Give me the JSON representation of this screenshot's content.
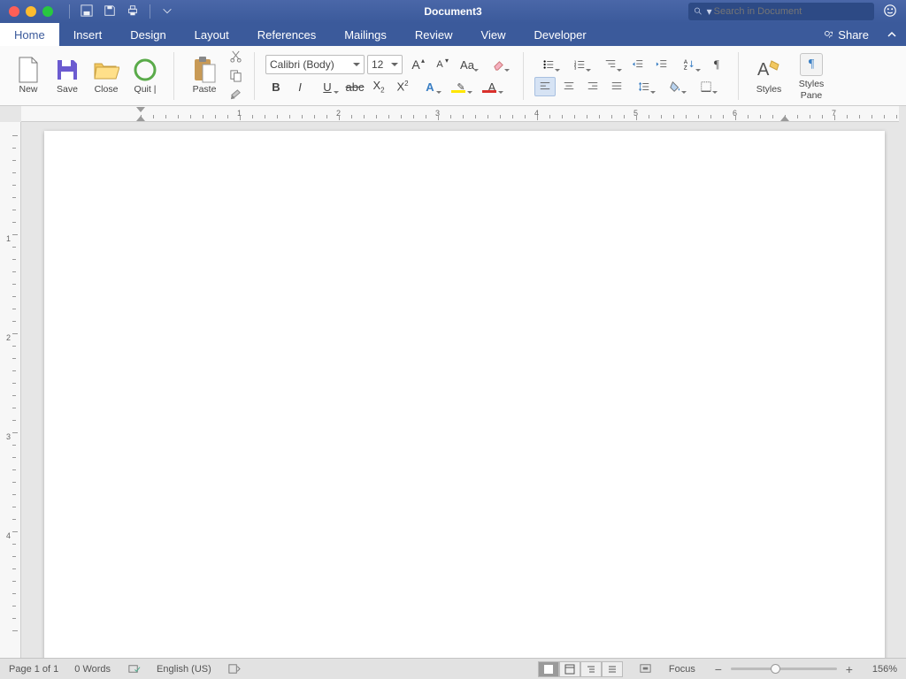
{
  "titlebar": {
    "doc_title": "Document3",
    "search_placeholder": "Search in Document"
  },
  "tabs": {
    "items": [
      "Home",
      "Insert",
      "Design",
      "Layout",
      "References",
      "Mailings",
      "Review",
      "View",
      "Developer"
    ],
    "active": 0,
    "share_label": "Share"
  },
  "ribbon": {
    "file": {
      "new": "New",
      "save": "Save",
      "close": "Close",
      "quit": "Quit |",
      "paste": "Paste"
    },
    "font": {
      "name": "Calibri (Body)",
      "size": "12"
    },
    "styles": {
      "styles": "Styles",
      "pane1": "Styles",
      "pane2": "Pane"
    }
  },
  "ruler_h": [
    1,
    2,
    3,
    4,
    5,
    6,
    7
  ],
  "ruler_v": [
    1,
    2,
    3,
    4
  ],
  "status": {
    "page": "Page 1 of 1",
    "words": "0 Words",
    "lang": "English (US)",
    "focus": "Focus",
    "zoom": "156%",
    "knob_pct": 42
  }
}
